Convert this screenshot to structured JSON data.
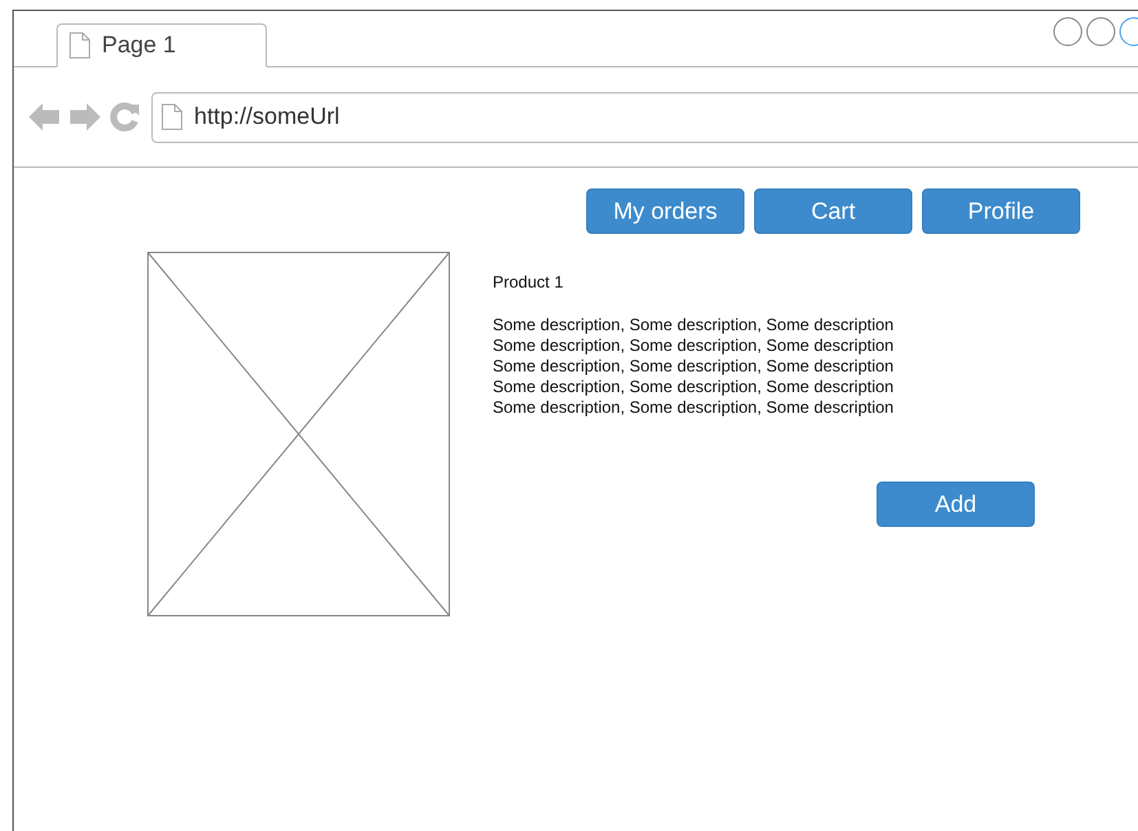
{
  "browser": {
    "tab": {
      "title": "Page 1",
      "selected": true
    },
    "address": "http://someUrl"
  },
  "nav_buttons": [
    "My orders",
    "Cart",
    "Profile"
  ],
  "product": {
    "kind": "picture",
    "title": "Product 1",
    "description_lines": [
      "Some description, Some description, Some description",
      "Some description, Some description, Some description",
      "Some description, Some description, Some description",
      "Some description, Some description, Some description",
      "Some description, Some description, Some description"
    ],
    "add_button": "Add"
  }
}
